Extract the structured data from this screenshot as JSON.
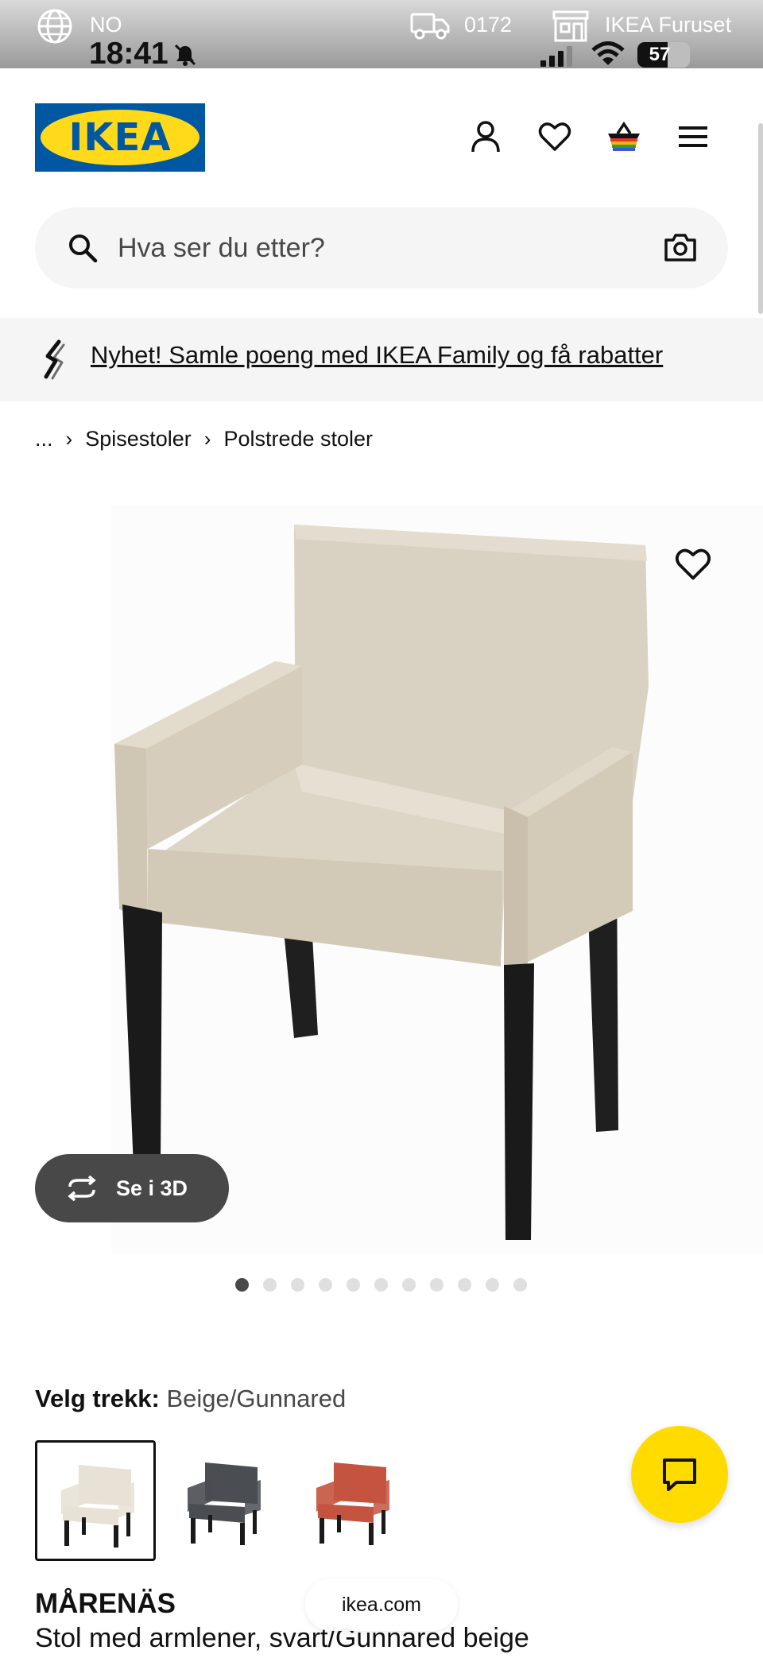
{
  "status_bar": {
    "language": "NO",
    "time": "18:41",
    "delivery_code": "0172",
    "store_name": "IKEA Furuset",
    "battery": "57",
    "battery_level": 0.57
  },
  "header": {
    "logo_text": "IKEA",
    "icons": [
      "account-icon",
      "heart-icon",
      "basket-icon",
      "menu-icon"
    ]
  },
  "search": {
    "placeholder": "Hva ser du etter?"
  },
  "promo": {
    "text": "Nyhet! Samle poeng med IKEA Family og få rabatter"
  },
  "breadcrumb": {
    "ellipsis": "...",
    "items": [
      "Spisestoler",
      "Polstrede stoler"
    ]
  },
  "gallery": {
    "see_3d_label": "Se i 3D",
    "image_count": 11,
    "active_index": 0
  },
  "cover": {
    "label": "Velg trekk:",
    "value": "Beige/Gunnared",
    "options": [
      {
        "name": "Beige/Gunnared",
        "color": "#e8e2d6",
        "selected": true
      },
      {
        "name": "dark grey",
        "color": "#4a4d52",
        "selected": false
      },
      {
        "name": "rust",
        "color": "#c4543f",
        "selected": false
      }
    ]
  },
  "product": {
    "name": "MÅRENÄS",
    "description": "Stol med armlener, svart/Gunnared beige"
  },
  "browser": {
    "url": "ikea.com"
  },
  "colors": {
    "ikea_blue": "#0058a3",
    "ikea_yellow": "#ffda1a",
    "chat_yellow": "#ffdb00"
  }
}
